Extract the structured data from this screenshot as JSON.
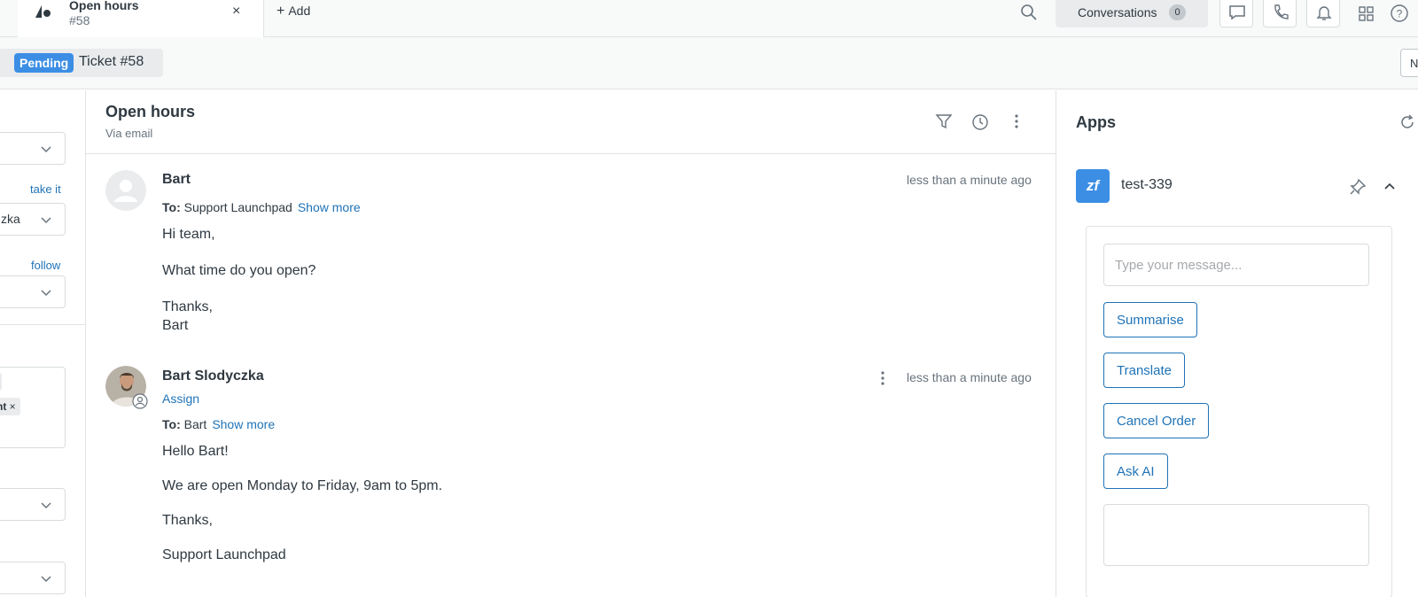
{
  "topbar": {
    "tab_title": "Open hours",
    "tab_subtitle": "#58",
    "close_glyph": "×",
    "add_label": "Add",
    "conversations_label": "Conversations",
    "conversations_count": "0",
    "icons": [
      "search-icon",
      "chat-icon",
      "phone-icon",
      "bell-icon",
      "grid-icon",
      "help-icon"
    ]
  },
  "subheader": {
    "status_badge": "Pending",
    "ticket_label": "Ticket #58",
    "next_button": "N"
  },
  "left": {
    "take_it": "take it",
    "assignee_value": "zka",
    "follow": "follow",
    "tag_close": "×",
    "tag_2": "nt"
  },
  "conversation": {
    "title": "Open hours",
    "subtitle": "Via email",
    "messages": [
      {
        "author": "Bart",
        "time": "less than a minute ago",
        "to_label": "To:",
        "to_value": "Support Launchpad",
        "show_more": "Show more",
        "lines": [
          "Hi team,",
          "What time do you open?",
          "Thanks,",
          "Bart"
        ]
      },
      {
        "author": "Bart Slodyczka",
        "time": "less than a minute ago",
        "assign": "Assign",
        "to_label": "To:",
        "to_value": "Bart",
        "show_more": "Show more",
        "lines": [
          "Hello Bart!",
          "We are open Monday to Friday, 9am to 5pm.",
          "Thanks,",
          "Support Launchpad"
        ]
      }
    ]
  },
  "apps": {
    "title": "Apps",
    "app_icon_text": "zf",
    "app_name": "test-339",
    "message_placeholder": "Type your message...",
    "buttons": [
      "Summarise",
      "Translate",
      "Cancel Order",
      "Ask AI"
    ]
  },
  "colors": {
    "accent": "#1f73b7",
    "badge": "#3c8ee5"
  }
}
